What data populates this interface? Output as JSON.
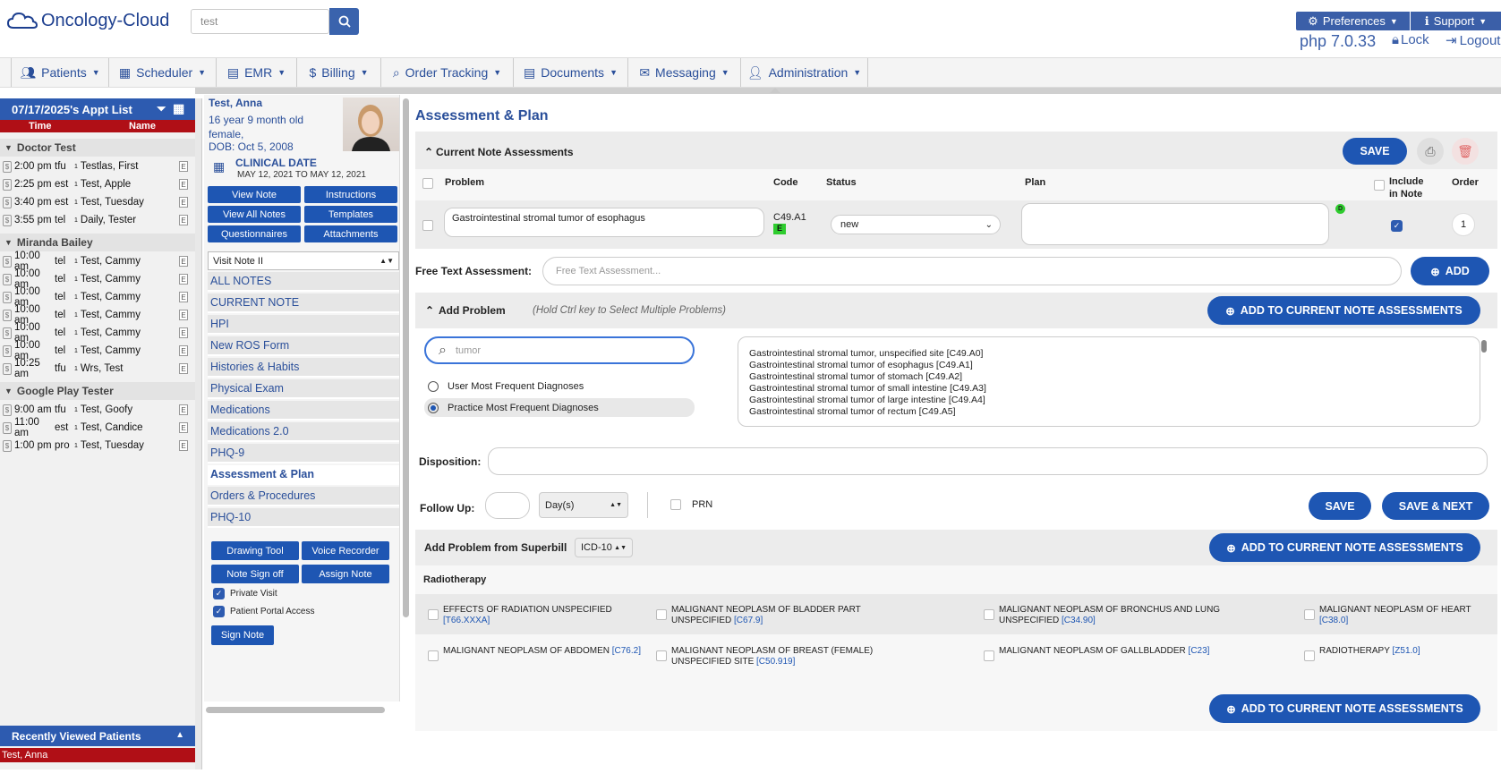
{
  "app": {
    "name": "Oncology-Cloud",
    "search_value": "test",
    "php_version": "php 7.0.33",
    "lock_label": "Lock",
    "logout_label": "Logout",
    "preferences_label": "Preferences",
    "support_label": "Support"
  },
  "nav": [
    {
      "label": "Patients"
    },
    {
      "label": "Scheduler"
    },
    {
      "label": "EMR"
    },
    {
      "label": "Billing"
    },
    {
      "label": "Order Tracking"
    },
    {
      "label": "Documents"
    },
    {
      "label": "Messaging"
    },
    {
      "label": "Administration"
    }
  ],
  "appt_list": {
    "title": "07/17/2025's Appt List",
    "col_time": "Time",
    "col_name": "Name",
    "groups": [
      {
        "provider": "Doctor Test",
        "appts": [
          {
            "time": "2:00 pm",
            "type": "tfu",
            "num": "1",
            "name": "Testlas, First"
          },
          {
            "time": "2:25 pm",
            "type": "est",
            "num": "1",
            "name": "Test, Apple"
          },
          {
            "time": "3:40 pm",
            "type": "est",
            "num": "1",
            "name": "Test, Tuesday"
          },
          {
            "time": "3:55 pm",
            "type": "tel",
            "num": "1",
            "name": "Daily, Tester"
          }
        ]
      },
      {
        "provider": "Miranda Bailey",
        "appts": [
          {
            "time": "10:00 am",
            "type": "tel",
            "num": "1",
            "name": "Test, Cammy"
          },
          {
            "time": "10:00 am",
            "type": "tel",
            "num": "1",
            "name": "Test, Cammy"
          },
          {
            "time": "10:00 am",
            "type": "tel",
            "num": "1",
            "name": "Test, Cammy"
          },
          {
            "time": "10:00 am",
            "type": "tel",
            "num": "1",
            "name": "Test, Cammy"
          },
          {
            "time": "10:00 am",
            "type": "tel",
            "num": "1",
            "name": "Test, Cammy"
          },
          {
            "time": "10:00 am",
            "type": "tel",
            "num": "1",
            "name": "Test, Cammy"
          },
          {
            "time": "10:25 am",
            "type": "tfu",
            "num": "1",
            "name": "Wrs, Test"
          }
        ]
      },
      {
        "provider": "Google Play Tester",
        "appts": [
          {
            "time": "9:00 am",
            "type": "tfu",
            "num": "1",
            "name": "Test, Goofy"
          },
          {
            "time": "11:00 am",
            "type": "est",
            "num": "1",
            "name": "Test, Candice"
          },
          {
            "time": "1:00 pm",
            "type": "pro",
            "num": "1",
            "name": "Test, Tuesday"
          }
        ]
      }
    ]
  },
  "recent": {
    "title": "Recently Viewed Patients",
    "patient": "Test, Anna"
  },
  "patient": {
    "name": "Test, Anna",
    "age": "16 year 9 month old female,",
    "dob": "DOB: Oct 5, 2008",
    "clinical_date_label": "CLINICAL DATE",
    "clinical_date_value": "MAY 12, 2021 TO MAY 12, 2021"
  },
  "note_buttons": [
    "View Note",
    "Instructions",
    "View All Notes",
    "Templates",
    "Questionnaires",
    "Attachments"
  ],
  "visit_note": "Visit Note II",
  "menu": [
    "ALL NOTES",
    "CURRENT NOTE",
    "HPI",
    "New ROS Form",
    "Histories & Habits",
    "Physical Exam",
    "Medications",
    "Medications 2.0",
    "PHQ-9",
    "Assessment & Plan",
    "Orders & Procedures",
    "PHQ-10"
  ],
  "tools": {
    "drawing": "Drawing Tool",
    "voice": "Voice Recorder",
    "signoff": "Note Sign off",
    "assign": "Assign Note",
    "private": "Private Visit",
    "portal": "Patient Portal Access",
    "sign": "Sign Note"
  },
  "main": {
    "title": "Assessment & Plan",
    "current": {
      "title": "Current Note Assessments",
      "save": "SAVE",
      "headers": {
        "problem": "Problem",
        "code": "Code",
        "status": "Status",
        "plan": "Plan",
        "include": "Include in Note",
        "order": "Order"
      },
      "row": {
        "problem": "Gastrointestinal stromal tumor of esophagus",
        "code": "C49.A1",
        "code_badge": "E",
        "status": "new",
        "plan": "",
        "order": "1",
        "dx_badge": "D"
      }
    },
    "free_text": {
      "label": "Free Text Assessment:",
      "placeholder": "Free Text Assessment...",
      "add": "ADD"
    },
    "add_problem": {
      "title": "Add Problem",
      "hint": "(Hold Ctrl key to Select Multiple Problems)",
      "button": "ADD TO CURRENT NOTE ASSESSMENTS",
      "search": "tumor",
      "radio_user": "User Most Frequent Diagnoses",
      "radio_practice": "Practice Most Frequent Diagnoses",
      "results": [
        "Gastrointestinal stromal tumor, unspecified site [C49.A0]",
        "Gastrointestinal stromal tumor of esophagus [C49.A1]",
        "Gastrointestinal stromal tumor of stomach [C49.A2]",
        "Gastrointestinal stromal tumor of small intestine [C49.A3]",
        "Gastrointestinal stromal tumor of large intestine [C49.A4]",
        "Gastrointestinal stromal tumor of rectum [C49.A5]"
      ]
    },
    "disposition": {
      "label": "Disposition:",
      "value": ""
    },
    "followup": {
      "label": "Follow Up:",
      "value": "",
      "unit": "Day(s)",
      "prn": "PRN",
      "save": "SAVE",
      "save_next": "SAVE & NEXT"
    },
    "superbill": {
      "title": "Add Problem from Superbill",
      "code_system": "ICD-10",
      "button": "ADD TO CURRENT NOTE ASSESSMENTS",
      "category": "Radiotherapy",
      "items": [
        {
          "text": "EFFECTS OF RADIATION UNSPECIFIED",
          "code": "[T66.XXXA]"
        },
        {
          "text": "MALIGNANT NEOPLASM OF BLADDER PART UNSPECIFIED",
          "code": "[C67.9]"
        },
        {
          "text": "MALIGNANT NEOPLASM OF BRONCHUS AND LUNG UNSPECIFIED",
          "code": "[C34.90]"
        },
        {
          "text": "MALIGNANT NEOPLASM OF HEART",
          "code": "[C38.0]"
        },
        {
          "text": "MALIGNANT NEOPLASM OF ABDOMEN",
          "code": "[C76.2]"
        },
        {
          "text": "MALIGNANT NEOPLASM OF BREAST (FEMALE) UNSPECIFIED SITE",
          "code": "[C50.919]"
        },
        {
          "text": "MALIGNANT NEOPLASM OF GALLBLADDER",
          "code": "[C23]"
        },
        {
          "text": "RADIOTHERAPY",
          "code": "[Z51.0]"
        }
      ]
    }
  }
}
